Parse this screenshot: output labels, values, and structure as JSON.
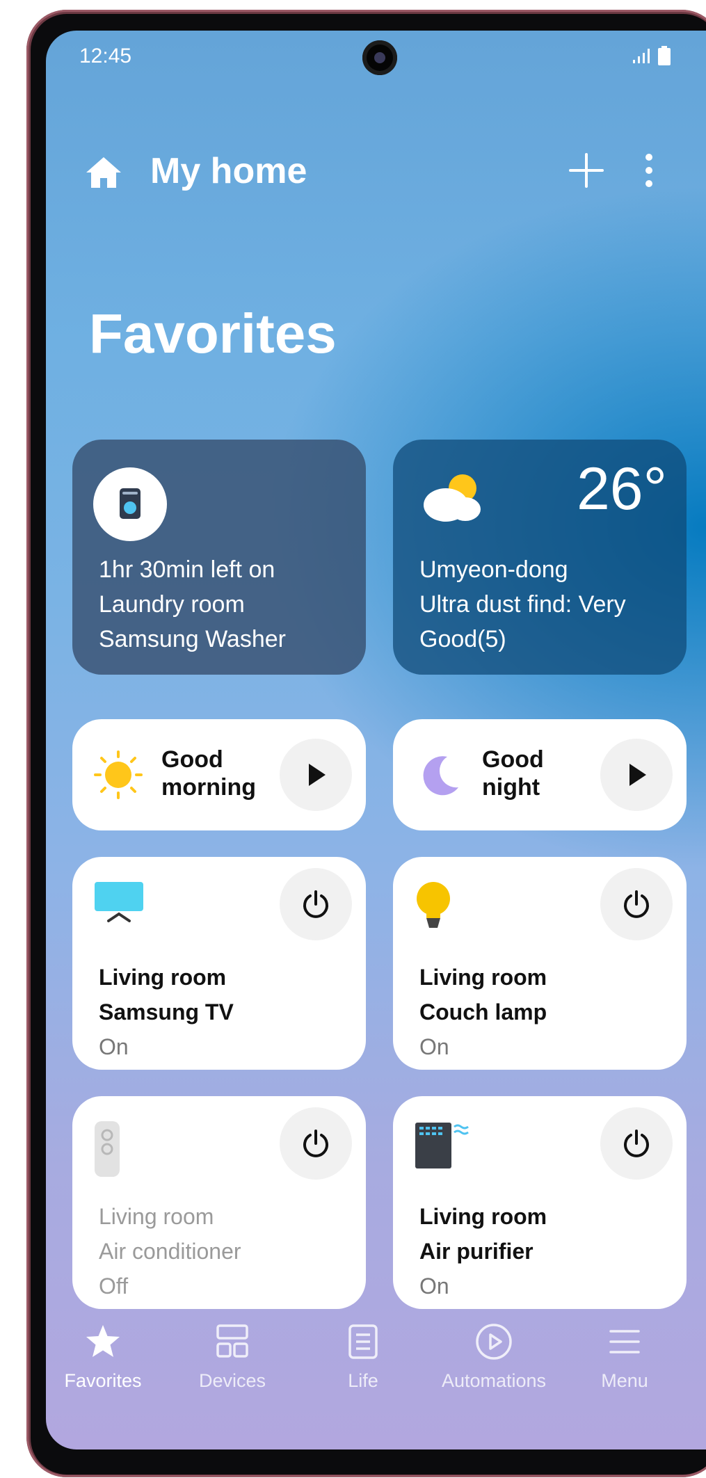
{
  "status_bar": {
    "time": "12:45"
  },
  "header": {
    "title": "My home"
  },
  "section": {
    "heading": "Favorites"
  },
  "status_cards": [
    {
      "icon": "washer-icon",
      "lines": [
        "1hr 30min left on",
        "Laundry room",
        "Samsung Washer"
      ]
    },
    {
      "icon": "partly-cloudy-icon",
      "temperature": "26°",
      "lines": [
        "Umyeon-dong",
        "Ultra dust find: Very",
        "Good(5)"
      ]
    }
  ],
  "scenes": [
    {
      "line1": "Good",
      "line2": "morning",
      "icon": "sun-icon"
    },
    {
      "line1": "Good",
      "line2": "night",
      "icon": "moon-icon"
    }
  ],
  "devices": [
    {
      "room": "Living room",
      "name": "Samsung TV",
      "state": "On",
      "icon": "tv-icon"
    },
    {
      "room": "Living room",
      "name": "Couch lamp",
      "state": "On",
      "icon": "lamp-icon"
    },
    {
      "room": "Living room",
      "name": "Air conditioner",
      "state": "Off",
      "icon": "air-conditioner-icon"
    },
    {
      "room": "Living room",
      "name": "Air purifier",
      "state": "On",
      "icon": "air-purifier-icon"
    }
  ],
  "nav": {
    "active": "Favorites",
    "items": [
      {
        "label": "Favorites",
        "icon": "star-icon"
      },
      {
        "label": "Devices",
        "icon": "devices-icon"
      },
      {
        "label": "Life",
        "icon": "life-icon"
      },
      {
        "label": "Automations",
        "icon": "automations-icon"
      },
      {
        "label": "Menu",
        "icon": "menu-icon"
      }
    ]
  },
  "colors": {
    "frame": "#6e3a44",
    "card_dark": "#344c6c",
    "card_blue": "#0e4876",
    "sun": "#ffc61a",
    "moon": "#b4a0f0",
    "tv": "#4fd2f0",
    "lamp": "#f7c400"
  }
}
